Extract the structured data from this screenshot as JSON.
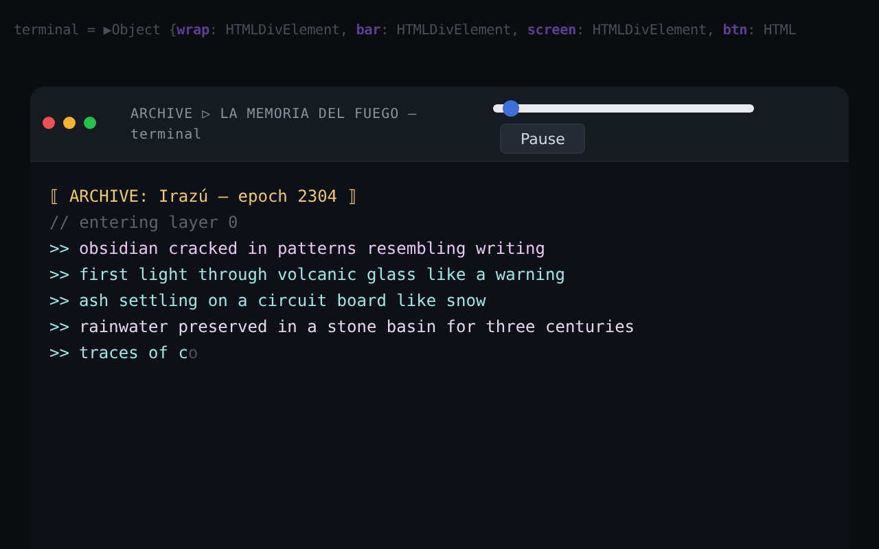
{
  "console": {
    "parts": [
      {
        "kind": "plain",
        "text": "terminal = ▶Object {"
      },
      {
        "kind": "key",
        "text": "wrap"
      },
      {
        "kind": "plain",
        "text": ": HTMLDivElement, "
      },
      {
        "kind": "key",
        "text": "bar"
      },
      {
        "kind": "plain",
        "text": ": HTMLDivElement, "
      },
      {
        "kind": "key",
        "text": "screen"
      },
      {
        "kind": "plain",
        "text": ": HTMLDivElement, "
      },
      {
        "kind": "key",
        "text": "btn"
      },
      {
        "kind": "plain",
        "text": ": HTML"
      }
    ]
  },
  "window": {
    "title": "ARCHIVE ▷ LA MEMORIA DEL FUEGO — terminal",
    "slider": {
      "level": 0.07
    },
    "button": "Pause",
    "lines": [
      {
        "kind": "header",
        "text": "⟦ ARCHIVE: Irazú — epoch 2304 ⟧"
      },
      {
        "kind": "comment",
        "text": "// entering layer 0"
      },
      {
        "kind": "output",
        "prompt": ">>",
        "text": "obsidian cracked in patterns resembling writing",
        "color": "#e8c6ef"
      },
      {
        "kind": "output",
        "prompt": ">>",
        "text": "first light through volcanic glass like a warning",
        "color": "#9ee6e6"
      },
      {
        "kind": "output",
        "prompt": ">>",
        "text": "ash settling on a circuit board like snow",
        "color": "#9ee6e6"
      },
      {
        "kind": "output",
        "prompt": ">>",
        "text": "rainwater preserved in a stone basin for three centuries",
        "color": "#e6d6ee"
      },
      {
        "kind": "output",
        "prompt": ">>",
        "text": "traces of c",
        "pending": "o",
        "color": "#9ee6e6"
      }
    ]
  }
}
